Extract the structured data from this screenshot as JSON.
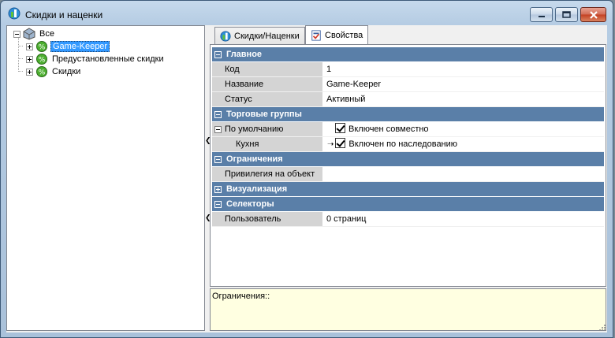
{
  "window": {
    "title": "Скидки и наценки"
  },
  "tree": {
    "root_label": "Все",
    "items": [
      {
        "label": "Game-Keeper",
        "selected": true
      },
      {
        "label": "Предустановленные скидки",
        "selected": false
      },
      {
        "label": "Скидки",
        "selected": false
      }
    ]
  },
  "tabs": [
    {
      "label": "Скидки/Наценки",
      "active": false
    },
    {
      "label": "Свойства",
      "active": true
    }
  ],
  "properties": {
    "categories": {
      "main": "Главное",
      "trade_groups": "Торговые группы",
      "restrictions": "Ограничения",
      "visualization": "Визуализация",
      "selectors": "Селекторы"
    },
    "rows": {
      "code": {
        "name": "Код",
        "value": "1"
      },
      "title": {
        "name": "Название",
        "value": "Game-Keeper"
      },
      "status": {
        "name": "Статус",
        "value": "Активный"
      },
      "default": {
        "name": "По умолчанию",
        "value": "Включен совместно"
      },
      "kitchen": {
        "name": "Кухня",
        "value": "Включен по наследованию"
      },
      "object_privilege": {
        "name": "Привилегия на объект",
        "value": ""
      },
      "user": {
        "name": "Пользователь",
        "value": "0 страниц"
      }
    }
  },
  "description": {
    "text": "Ограничения::"
  },
  "colors": {
    "category_bg": "#5a7fa8",
    "selection": "#3399ff",
    "description_bg": "#ffffe1"
  }
}
